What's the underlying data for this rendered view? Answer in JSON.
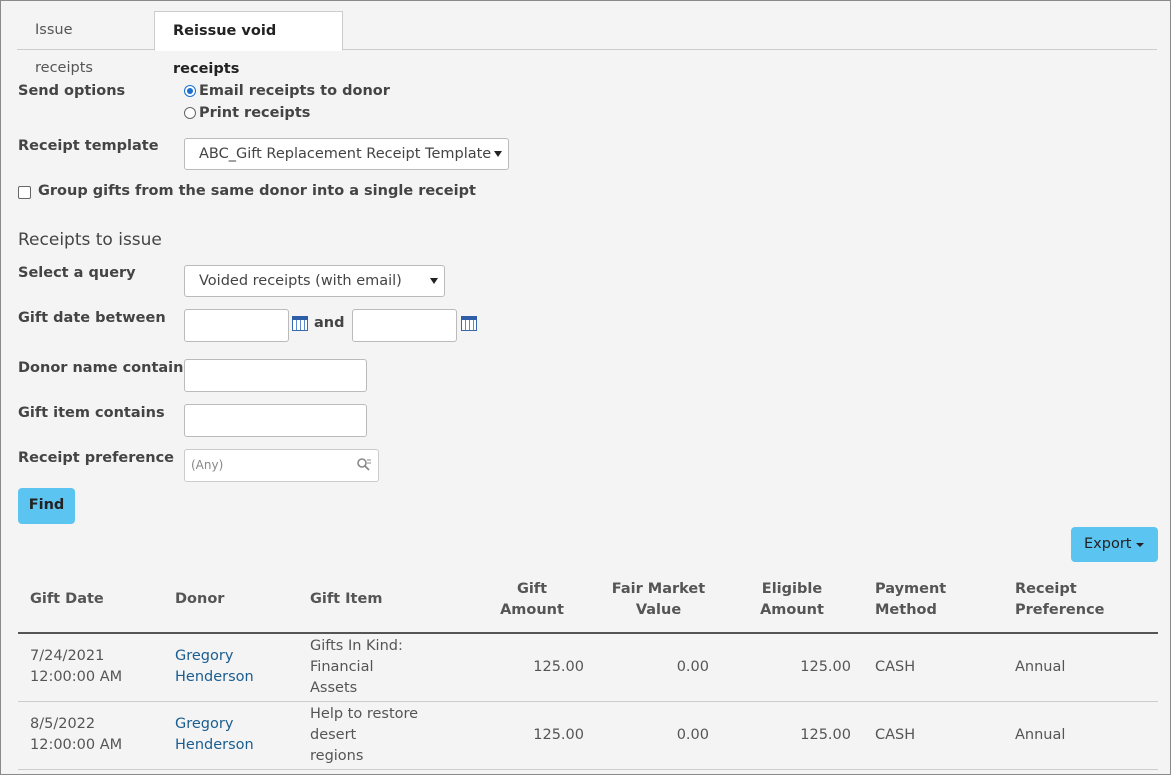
{
  "tabs": [
    {
      "label": "Issue receipts"
    },
    {
      "label": "Reissue void receipts"
    }
  ],
  "send_options": {
    "label": "Send options",
    "options": [
      "Email receipts to donor",
      "Print receipts"
    ],
    "selected": "Email receipts to donor"
  },
  "receipt_template": {
    "label": "Receipt template",
    "value": "ABC_Gift Replacement Receipt Template"
  },
  "group_gifts": {
    "label": "Group gifts from the same donor into a single receipt",
    "checked": false
  },
  "receipts_to_issue": {
    "title": "Receipts to issue",
    "query_label": "Select a query",
    "query_value": "Voided receipts (with email)",
    "gift_date_label": "Gift date between",
    "and_label": "and",
    "gift_date_from": "",
    "gift_date_to": "",
    "donor_name_label": "Donor name contains",
    "donor_name_value": "",
    "gift_item_label": "Gift item contains",
    "gift_item_value": "",
    "pref_label": "Receipt preference",
    "pref_placeholder": "(Any)",
    "find_label": "Find"
  },
  "export_label": "Export",
  "table": {
    "headers": [
      "Gift Date",
      "Donor",
      "Gift Item",
      "Gift Amount",
      "Fair Market Value",
      "Eligible Amount",
      "Payment Method",
      "Receipt Preference"
    ],
    "header_lines": [
      [
        "Gift Date"
      ],
      [
        "Donor"
      ],
      [
        "Gift Item"
      ],
      [
        "Gift",
        "Amount"
      ],
      [
        "Fair Market",
        "Value"
      ],
      [
        "Eligible",
        "Amount"
      ],
      [
        "Payment",
        "Method"
      ],
      [
        "Receipt",
        "Preference"
      ]
    ],
    "rows": [
      {
        "date": "7/24/2021",
        "time": "12:00:00 AM",
        "donor_first": "Gregory",
        "donor_last": "Henderson",
        "item_line1": "Gifts In Kind: Financial",
        "item_line2": "Assets",
        "amount": "125.00",
        "fmv": "0.00",
        "eligible": "125.00",
        "method": "CASH",
        "pref": "Annual"
      },
      {
        "date": "8/5/2022",
        "time": "12:00:00 AM",
        "donor_first": "Gregory",
        "donor_last": "Henderson",
        "item_line1": "Help to restore desert",
        "item_line2": "regions",
        "amount": "125.00",
        "fmv": "0.00",
        "eligible": "125.00",
        "method": "CASH",
        "pref": "Annual"
      }
    ]
  },
  "colors": {
    "accent": "#5bc4f1",
    "link": "#1a5d8f",
    "radio": "#1a6fd1"
  }
}
